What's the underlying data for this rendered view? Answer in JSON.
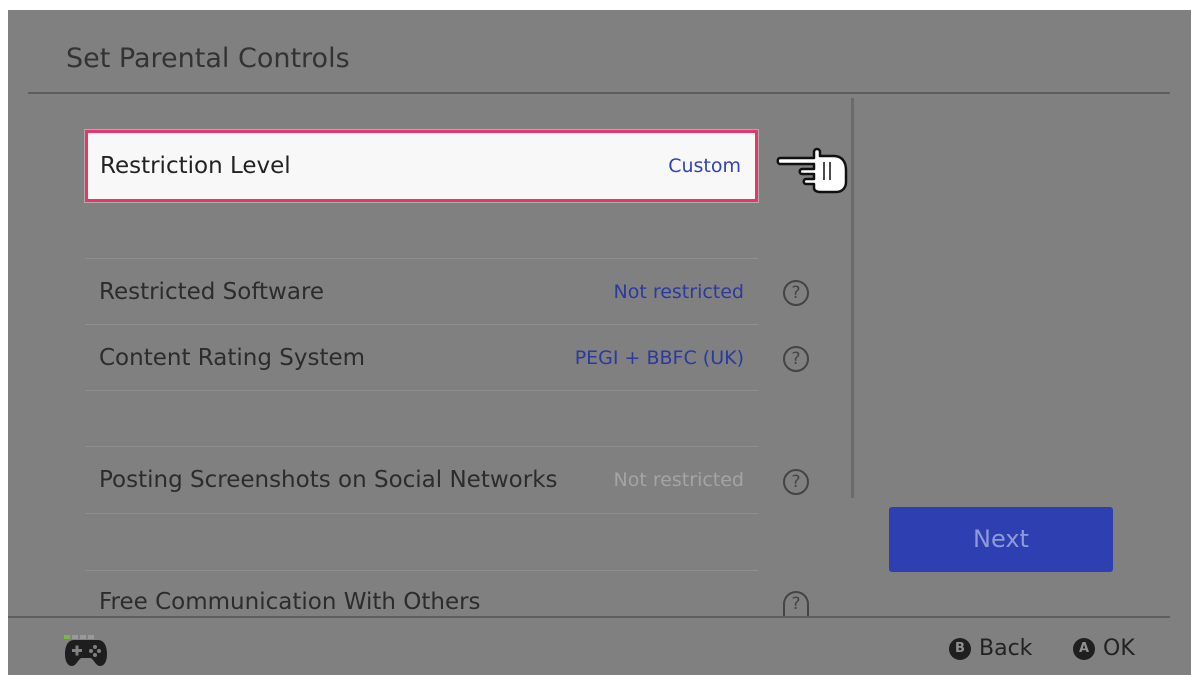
{
  "header": {
    "title": "Set Parental Controls"
  },
  "settings": [
    {
      "label": "Restriction Level",
      "value": "Custom",
      "selected": true,
      "help": false
    },
    {
      "label": "Restricted Software",
      "value": "Not restricted",
      "help": true
    },
    {
      "label": "Content Rating System",
      "value": "PEGI + BBFC (UK)",
      "help": true
    },
    {
      "label": "Posting Screenshots on Social Networks",
      "value": "Not restricted",
      "muted": true,
      "help": true
    },
    {
      "label": "Free Communication With Others",
      "value": "",
      "help": true
    }
  ],
  "help_glyph": "?",
  "next_button": {
    "label": "Next"
  },
  "footer": {
    "back": {
      "button_glyph": "B",
      "label": "Back"
    },
    "ok": {
      "button_glyph": "A",
      "label": "OK"
    }
  },
  "icons": {
    "pointer": "hand-pointer-icon",
    "controller": "gamepad-icon",
    "help": "question-circle-icon"
  },
  "colors": {
    "background": "#808080",
    "accent_blue": "#2e3fb2",
    "selection_border": "#e8366a",
    "value_text": "#2a3a9e",
    "controller_indicator": "#7ab640"
  }
}
